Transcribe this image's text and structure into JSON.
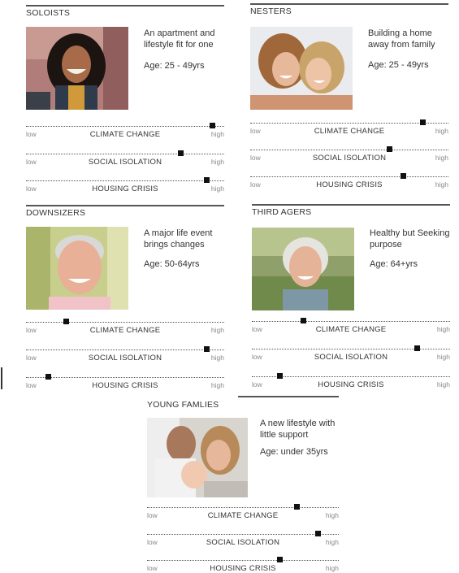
{
  "personas": [
    {
      "key": "soloists",
      "name": "SOLOISTS",
      "description": "An apartment and lifestyle fit for one",
      "age": "Age: 25 - 49yrs",
      "photo_icon": "smiling-young-woman-photo",
      "scales": [
        {
          "label": "CLIMATE CHANGE",
          "low": "low",
          "high": "high",
          "level": 0.94
        },
        {
          "label": "SOCIAL ISOLATION",
          "low": "low",
          "high": "high",
          "level": 0.78
        },
        {
          "label": "HOUSING CRISIS",
          "low": "low",
          "high": "high",
          "level": 0.91
        }
      ]
    },
    {
      "key": "nesters",
      "name": "NESTERS",
      "description": "Building a home away from family",
      "age": "Age: 25 - 49yrs",
      "photo_icon": "two-women-embracing-photo",
      "scales": [
        {
          "label": "CLIMATE CHANGE",
          "low": "low",
          "high": "high",
          "level": 0.87
        },
        {
          "label": "SOCIAL ISOLATION",
          "low": "low",
          "high": "high",
          "level": 0.7
        },
        {
          "label": "HOUSING CRISIS",
          "low": "low",
          "high": "high",
          "level": 0.77
        }
      ]
    },
    {
      "key": "downsizers",
      "name": "DOWNSIZERS",
      "description": "A major life event brings changes",
      "age": "Age: 50-64yrs",
      "photo_icon": "smiling-older-man-photo",
      "scales": [
        {
          "label": "CLIMATE CHANGE",
          "low": "low",
          "high": "high",
          "level": 0.2
        },
        {
          "label": "SOCIAL ISOLATION",
          "low": "low",
          "high": "high",
          "level": 0.91
        },
        {
          "label": "HOUSING CRISIS",
          "low": "low",
          "high": "high",
          "level": 0.11
        }
      ]
    },
    {
      "key": "third-agers",
      "name": "THIRD AGERS",
      "description": "Healthy but Seeking purpose",
      "age": "Age: 64+yrs",
      "photo_icon": "older-woman-outdoors-photo",
      "scales": [
        {
          "label": "CLIMATE CHANGE",
          "low": "low",
          "high": "high",
          "level": 0.26
        },
        {
          "label": "SOCIAL ISOLATION",
          "low": "low",
          "high": "high",
          "level": 0.83
        },
        {
          "label": "HOUSING CRISIS",
          "low": "low",
          "high": "high",
          "level": 0.14
        }
      ]
    },
    {
      "key": "young-families",
      "name": "YOUNG FAMLIES",
      "description": "A new lifestyle with little support",
      "age": "Age: under 35yrs",
      "photo_icon": "parents-with-baby-photo",
      "scales": [
        {
          "label": "CLIMATE CHANGE",
          "low": "low",
          "high": "high",
          "level": 0.78
        },
        {
          "label": "SOCIAL ISOLATION",
          "low": "low",
          "high": "high",
          "level": 0.89
        },
        {
          "label": "HOUSING CRISIS",
          "low": "low",
          "high": "high",
          "level": 0.69
        }
      ]
    }
  ]
}
